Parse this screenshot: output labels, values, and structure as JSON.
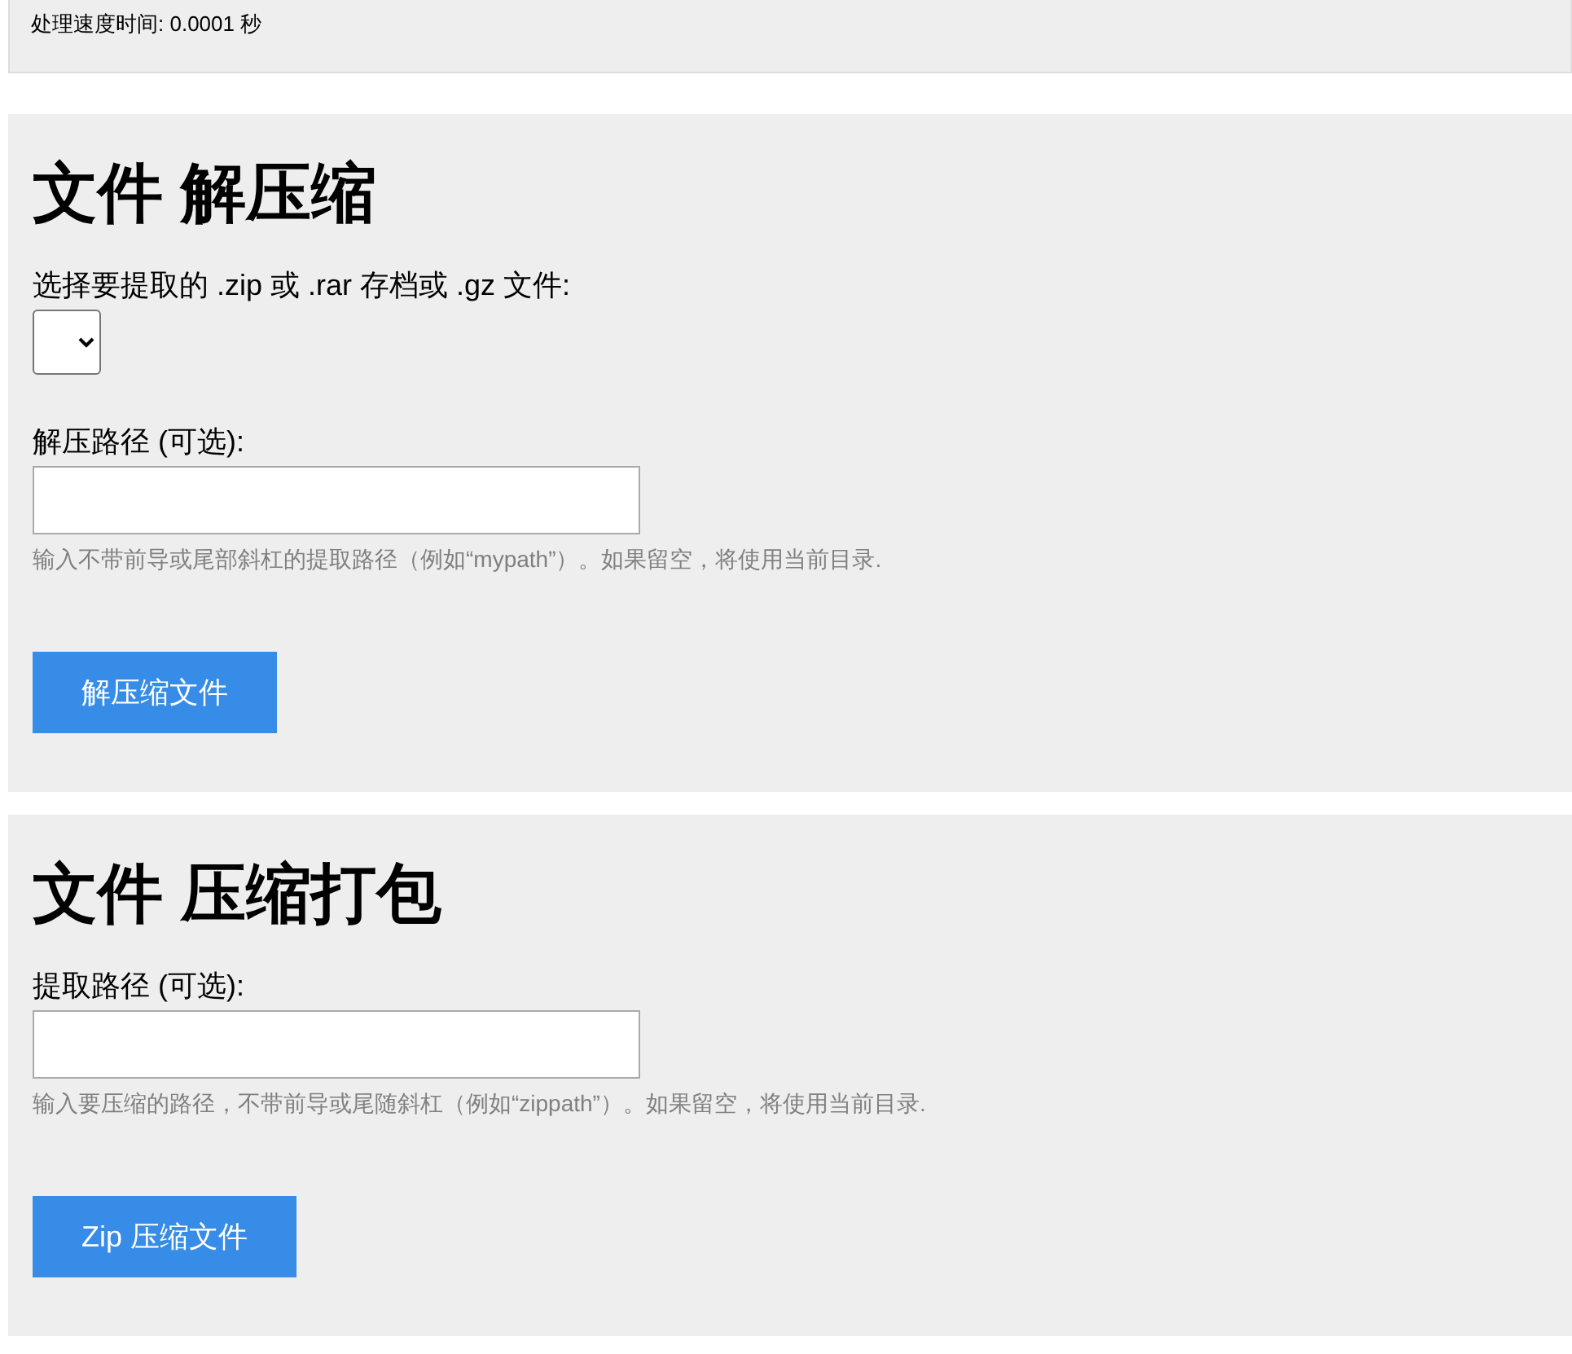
{
  "status": {
    "text": "处理速度时间: 0.0001 秒"
  },
  "sections": [
    {
      "title": "文件 解压缩",
      "fields": [
        {
          "kind": "select",
          "label": "选择要提取的 .zip 或 .rar 存档或 .gz 文件:"
        },
        {
          "kind": "text",
          "label": "解压路径 (可选):",
          "help": "输入不带前导或尾部斜杠的提取路径（例如“mypath”）。如果留空，将使用当前目录."
        }
      ],
      "button": "解压缩文件"
    },
    {
      "title": "文件 压缩打包",
      "fields": [
        {
          "kind": "text",
          "label": "提取路径 (可选):",
          "help": "输入要压缩的路径，不带前导或尾随斜杠（例如“zippath”）。如果留空，将使用当前目录."
        }
      ],
      "button": "Zip 压缩文件"
    }
  ]
}
